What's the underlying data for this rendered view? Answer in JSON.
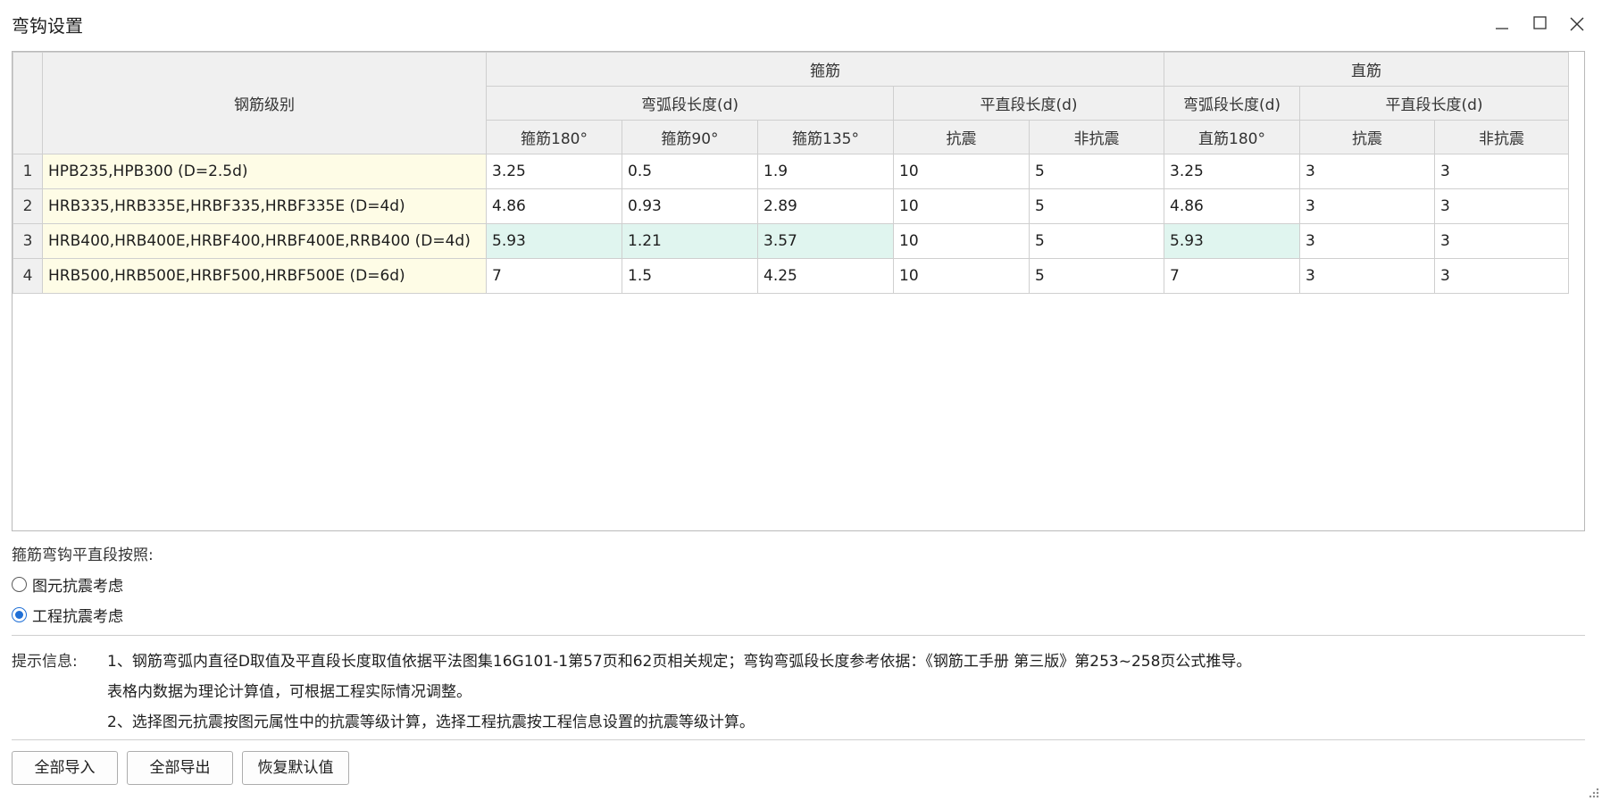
{
  "window": {
    "title": "弯钩设置",
    "controls": [
      "minimize-icon",
      "maximize-icon",
      "close-icon"
    ]
  },
  "table": {
    "group_headers": {
      "stirrup": "箍筋",
      "straight": "直筋"
    },
    "grade_header": "钢筋级别",
    "sub_headers": {
      "stirrup_arc": "弯弧段长度(d)",
      "stirrup_flat": "平直段长度(d)",
      "straight_arc": "弯弧段长度(d)",
      "straight_flat": "平直段长度(d)"
    },
    "columns": [
      "箍筋180°",
      "箍筋90°",
      "箍筋135°",
      "抗震",
      "非抗震",
      "直筋180°",
      "抗震",
      "非抗震"
    ],
    "rows": [
      {
        "num": "1",
        "grade": "HPB235,HPB300 (D=2.5d)",
        "values": [
          "3.25",
          "0.5",
          "1.9",
          "10",
          "5",
          "3.25",
          "3",
          "3"
        ]
      },
      {
        "num": "2",
        "grade": "HRB335,HRB335E,HRBF335,HRBF335E (D=4d)",
        "values": [
          "4.86",
          "0.93",
          "2.89",
          "10",
          "5",
          "4.86",
          "3",
          "3"
        ]
      },
      {
        "num": "3",
        "grade": "HRB400,HRB400E,HRBF400,HRBF400E,RRB400 (D=4d)",
        "values": [
          "5.93",
          "1.21",
          "3.57",
          "10",
          "5",
          "5.93",
          "3",
          "3"
        ]
      },
      {
        "num": "4",
        "grade": "HRB500,HRB500E,HRBF500,HRBF500E (D=6d)",
        "values": [
          "7",
          "1.5",
          "4.25",
          "10",
          "5",
          "7",
          "3",
          "3"
        ]
      }
    ]
  },
  "options": {
    "label": "箍筋弯钩平直段按照:",
    "radios": [
      {
        "label": "图元抗震考虑",
        "checked": false
      },
      {
        "label": "工程抗震考虑",
        "checked": true
      }
    ]
  },
  "tips": {
    "label": "提示信息:",
    "lines": [
      "1、钢筋弯弧内直径D取值及平直段长度取值依据平法图集16G101-1第57页和62页相关规定；弯钩弯弧段长度参考依据：《钢筋工手册  第三版》第253~258页公式推导。",
      "表格内数据为理论计算值，可根据工程实际情况调整。",
      "2、选择图元抗震按图元属性中的抗震等级计算，选择工程抗震按工程信息设置的抗震等级计算。"
    ]
  },
  "buttons": {
    "import_all": "全部导入",
    "export_all": "全部导出",
    "restore_default": "恢复默认值"
  },
  "colors": {
    "grade_cell_bg": "#fefce6",
    "highlight_cell_bg": "#e0f5ef",
    "header_bg": "#f0f0f0",
    "radio_accent": "#1f6fd6"
  }
}
